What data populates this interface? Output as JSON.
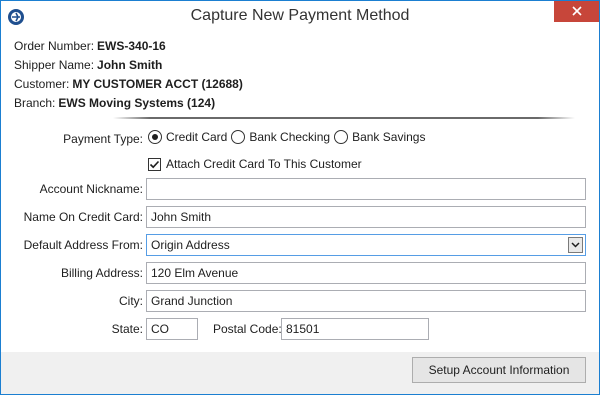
{
  "window": {
    "title": "Capture New Payment Method"
  },
  "order": {
    "order_number_label": "Order Number:",
    "order_number": "EWS-340-16",
    "shipper_label": "Shipper Name:",
    "shipper": "John Smith",
    "customer_label": "Customer:",
    "customer": "MY CUSTOMER ACCT (12688)",
    "branch_label": "Branch:",
    "branch": "EWS Moving Systems (124)"
  },
  "form": {
    "payment_type_label": "Payment Type:",
    "payment_options": [
      {
        "label": "Credit Card",
        "selected": true
      },
      {
        "label": "Bank Checking",
        "selected": false
      },
      {
        "label": "Bank Savings",
        "selected": false
      }
    ],
    "attach_label": "Attach Credit Card To This Customer",
    "attach_checked": true,
    "nickname_label": "Account Nickname:",
    "nickname": "",
    "name_label": "Name On Credit Card:",
    "name": "John Smith",
    "address_from_label": "Default Address From:",
    "address_from": "Origin Address",
    "billing_label": "Billing Address:",
    "billing": "120 Elm Avenue",
    "city_label": "City:",
    "city": "Grand Junction",
    "state_label": "State:",
    "state": "CO",
    "postal_label": "Postal Code:",
    "postal": "81501"
  },
  "footer": {
    "setup_label": "Setup Account Information"
  },
  "icons": {
    "app": "app-logo-icon",
    "close": "close-icon",
    "dropdown": "chevron-down-icon",
    "check": "check-icon"
  },
  "colors": {
    "border_accent": "#1b7fd1",
    "close_bg": "#c7463a",
    "footer_bg": "#f0f0f0"
  }
}
